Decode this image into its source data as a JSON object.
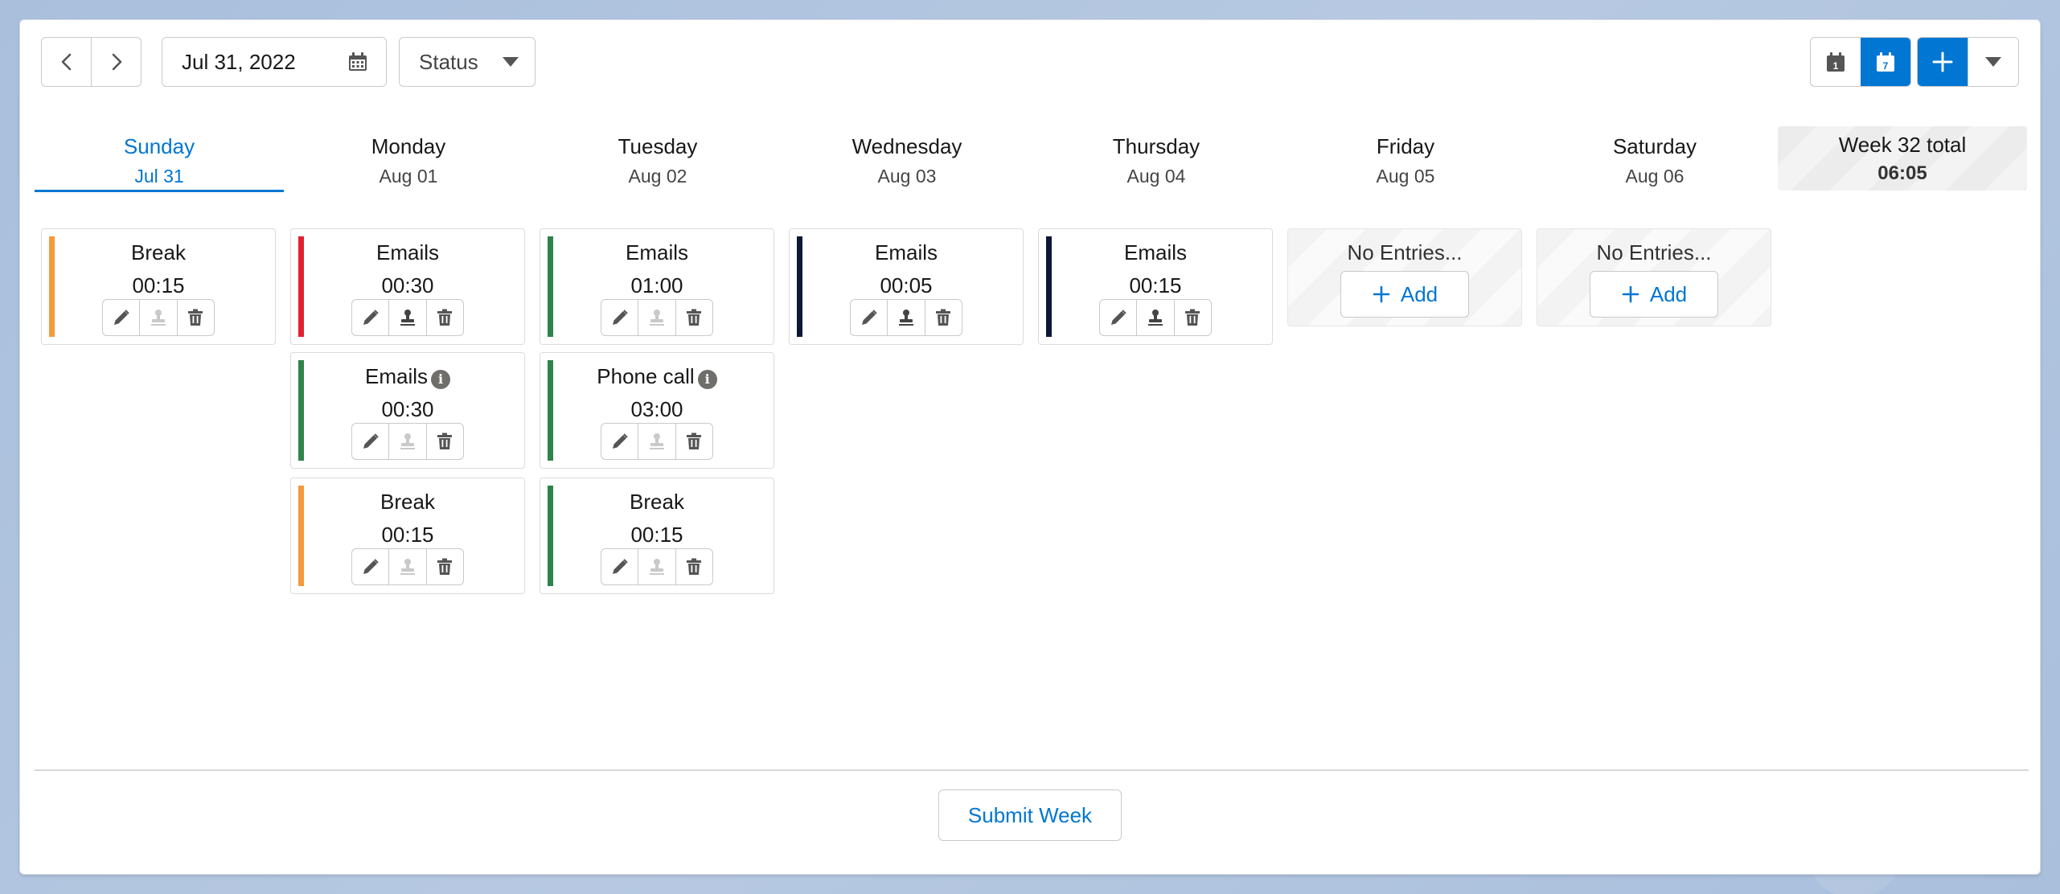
{
  "toolbar": {
    "date_value": "Jul 31, 2022",
    "status_label": "Status",
    "prev_icon": "chevron-left-icon",
    "next_icon": "chevron-right-icon",
    "calendar_icon": "calendar-icon",
    "dropdown_icon": "chevron-down-icon",
    "day_view_number": "1",
    "week_view_number": "7",
    "active_view": "week"
  },
  "days": [
    {
      "name": "Sunday",
      "date": "Jul 31"
    },
    {
      "name": "Monday",
      "date": "Aug 01"
    },
    {
      "name": "Tuesday",
      "date": "Aug 02"
    },
    {
      "name": "Wednesday",
      "date": "Aug 03"
    },
    {
      "name": "Thursday",
      "date": "Aug 04"
    },
    {
      "name": "Friday",
      "date": "Aug 05"
    },
    {
      "name": "Saturday",
      "date": "Aug 06"
    }
  ],
  "active_day": "Sunday",
  "week_total": {
    "label": "Week 32 total",
    "value": "06:05"
  },
  "entries": {
    "sunday": [
      {
        "title": "Break",
        "time": "00:15",
        "color": "#f59a3c",
        "info": false
      }
    ],
    "monday": [
      {
        "title": "Emails",
        "time": "00:30",
        "color": "#e3202f",
        "info": false
      },
      {
        "title": "Emails",
        "time": "00:30",
        "color": "#2e844a",
        "info": true
      },
      {
        "title": "Break",
        "time": "00:15",
        "color": "#f59a3c",
        "info": false
      }
    ],
    "tuesday": [
      {
        "title": "Emails",
        "time": "01:00",
        "color": "#2e844a",
        "info": false
      },
      {
        "title": "Phone call",
        "time": "03:00",
        "color": "#2e844a",
        "info": true
      },
      {
        "title": "Break",
        "time": "00:15",
        "color": "#2e844a",
        "info": false
      }
    ],
    "wednesday": [
      {
        "title": "Emails",
        "time": "00:05",
        "color": "#0b1736",
        "info": false
      }
    ],
    "thursday": [
      {
        "title": "Emails",
        "time": "00:15",
        "color": "#0b1736",
        "info": false
      }
    ]
  },
  "empty": {
    "label": "No Entries...",
    "add_label": "Add"
  },
  "info_glyph": "i",
  "footer": {
    "submit_label": "Submit Week"
  }
}
